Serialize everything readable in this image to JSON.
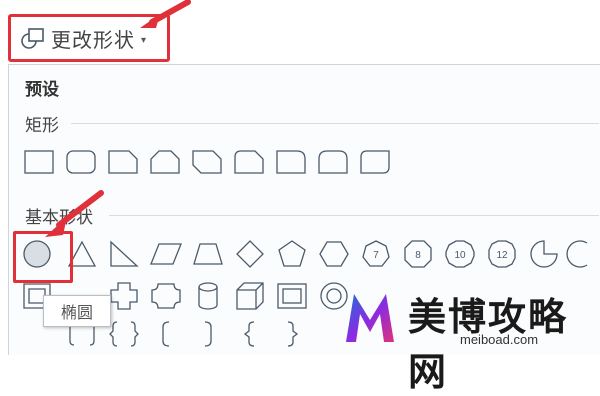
{
  "toolbar": {
    "change_shape_label": "更改形状",
    "caret": "▾"
  },
  "panel": {
    "preset_label": "预设",
    "sections": {
      "rectangle": {
        "title": "矩形"
      },
      "basic_shapes": {
        "title": "基本形状"
      }
    },
    "octagon_number_labels": [
      "7",
      "8",
      "10",
      "12"
    ],
    "tooltip": "椭圆"
  },
  "watermark": {
    "title": "美博攻略网",
    "url": "meiboad.com"
  },
  "colors": {
    "highlight_red": "#e0303a",
    "shape_stroke": "#4a5a6a",
    "selected_fill": "#d9dee4",
    "logo_blue": "#1f6fd6",
    "logo_purple": "#8a2be2",
    "logo_pink": "#e0307a"
  }
}
